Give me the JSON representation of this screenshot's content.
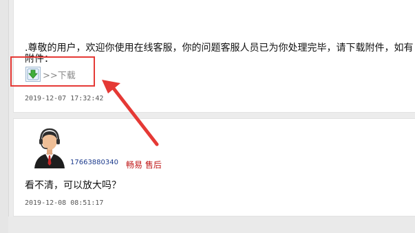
{
  "message1": {
    "text": ".尊敬的用户，欢迎你使用在线客服，你的问题客服人员已为你处理完毕，请下载附件，如有",
    "text_cont": "附件：",
    "download_label": ">>下载",
    "timestamp": "2019-12-07 17:32:42"
  },
  "message2": {
    "user_id": "17663880340",
    "user_name": "畅易 售后",
    "text": "看不清，可以放大吗？",
    "timestamp": "2019-12-08 08:51:17"
  },
  "colors": {
    "annotation": "#e53935",
    "user_id": "#1b3a8c",
    "user_name": "#c01818"
  },
  "icons": [
    "download-icon",
    "avatar-icon"
  ]
}
